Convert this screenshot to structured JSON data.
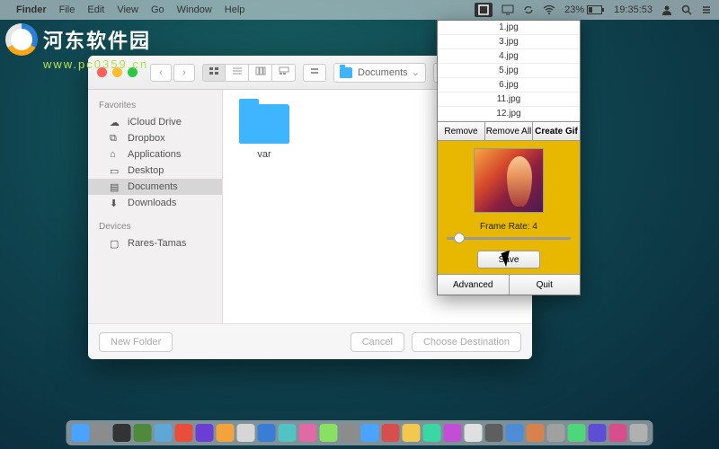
{
  "menubar": {
    "apple": "",
    "app": "Finder",
    "items": [
      "File",
      "Edit",
      "View",
      "Go",
      "Window",
      "Help"
    ],
    "status": {
      "battery_pct": "23%",
      "time": "19:35:53"
    }
  },
  "watermark": {
    "title": "河东软件园",
    "url": "www.pc0359.cn"
  },
  "finder": {
    "path_label": "Documents",
    "sidebar": {
      "favorites_head": "Favorites",
      "favorites": [
        "iCloud Drive",
        "Dropbox",
        "Applications",
        "Desktop",
        "Documents",
        "Downloads"
      ],
      "selected": "Documents",
      "devices_head": "Devices",
      "devices": [
        "Rares-Tamas"
      ]
    },
    "content": {
      "folder_name": "var"
    },
    "bottom": {
      "new_folder": "New Folder",
      "cancel": "Cancel",
      "choose": "Choose Destination"
    }
  },
  "gif": {
    "files": [
      "1.jpg",
      "3.jpg",
      "4.jpg",
      "5.jpg",
      "6.jpg",
      "11.jpg",
      "12.jpg"
    ],
    "remove": "Remove",
    "remove_all": "Remove All",
    "create": "Create Gif",
    "frame_rate_label": "Frame Rate: 4",
    "save": "Save",
    "advanced": "Advanced",
    "quit": "Quit"
  },
  "dock_colors": [
    "#4aa3ff",
    "#8c8c8c",
    "#333",
    "#4f8a3a",
    "#5ea7d6",
    "#e94e3a",
    "#6b3fd6",
    "#f2a33b",
    "#d6d6d6",
    "#3a7dd6",
    "#52c2c2",
    "#e06aa3",
    "#8ae060",
    "#8c8c8c",
    "#4aa3ff",
    "#d64e4e",
    "#f2c84e",
    "#3ad6a3",
    "#c24ed6",
    "#e0e0e0",
    "#5e5e5e",
    "#4e8cd6",
    "#d6824e",
    "#a0a0a0",
    "#4ed67a",
    "#5e4ed6",
    "#d64e8c",
    "#b0b0b0"
  ]
}
